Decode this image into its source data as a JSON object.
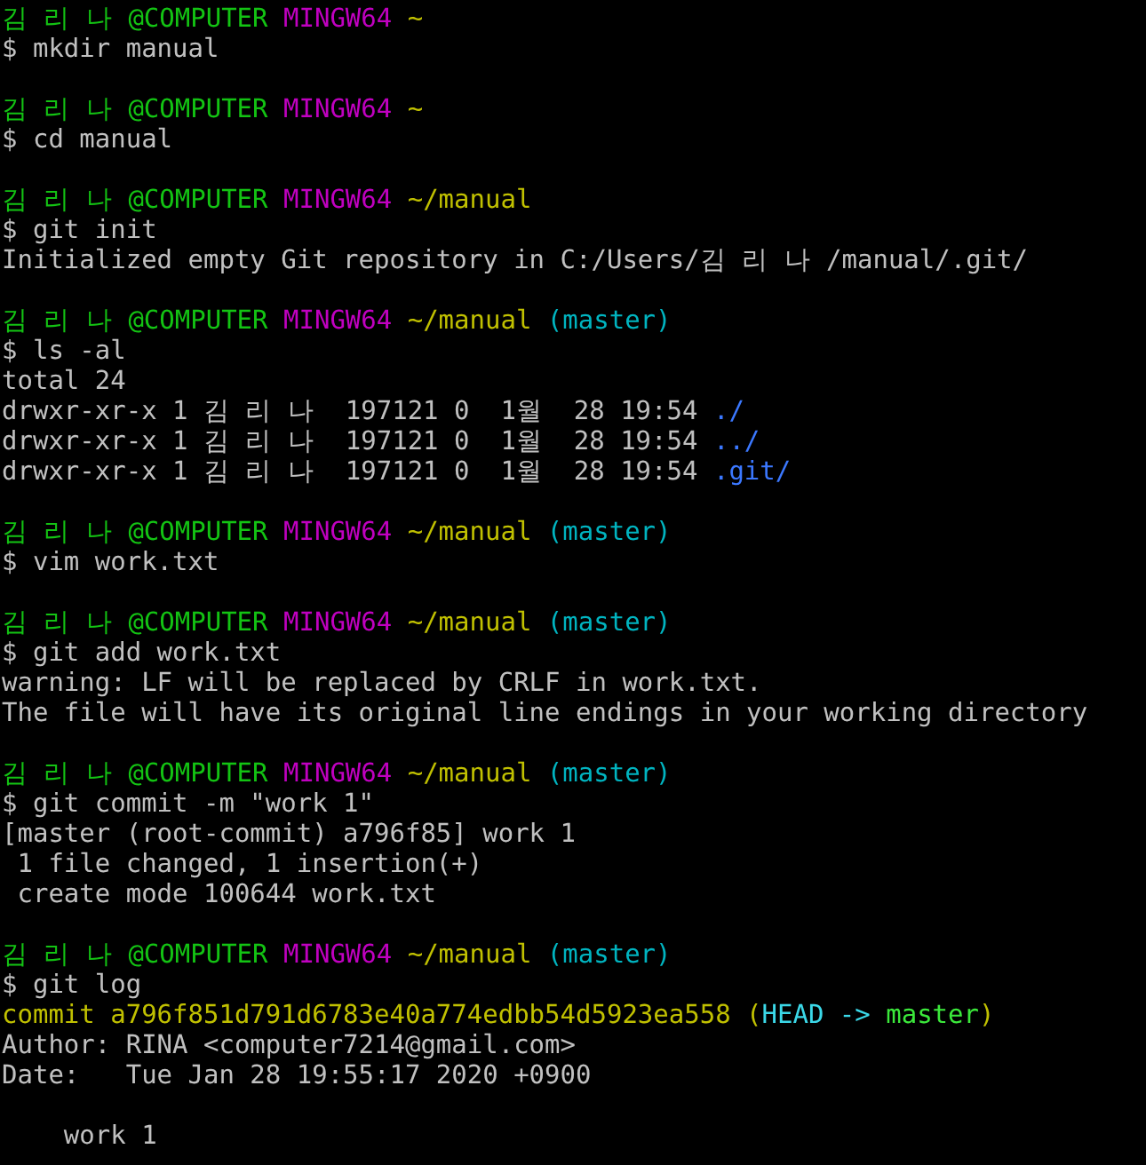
{
  "terminal": {
    "lines": [
      {
        "kind": "prompt",
        "segments": [
          {
            "text": "김 리 나 @COMPUTER ",
            "color": "#13c313"
          },
          {
            "text": "MINGW64 ",
            "color": "#c000c0"
          },
          {
            "text": "~",
            "color": "#c0c000"
          }
        ]
      },
      {
        "kind": "command",
        "segments": [
          {
            "text": "$ mkdir manual",
            "color": "#c0c0c0"
          }
        ]
      },
      {
        "kind": "blank"
      },
      {
        "kind": "prompt",
        "segments": [
          {
            "text": "김 리 나 @COMPUTER ",
            "color": "#13c313"
          },
          {
            "text": "MINGW64 ",
            "color": "#c000c0"
          },
          {
            "text": "~",
            "color": "#c0c000"
          }
        ]
      },
      {
        "kind": "command",
        "segments": [
          {
            "text": "$ cd manual",
            "color": "#c0c0c0"
          }
        ]
      },
      {
        "kind": "blank"
      },
      {
        "kind": "prompt",
        "segments": [
          {
            "text": "김 리 나 @COMPUTER ",
            "color": "#13c313"
          },
          {
            "text": "MINGW64 ",
            "color": "#c000c0"
          },
          {
            "text": "~/manual",
            "color": "#c0c000"
          }
        ]
      },
      {
        "kind": "command",
        "segments": [
          {
            "text": "$ git init",
            "color": "#c0c0c0"
          }
        ]
      },
      {
        "kind": "output",
        "segments": [
          {
            "text": "Initialized empty Git repository in C:/Users/김 리 나 /manual/.git/",
            "color": "#c0c0c0"
          }
        ]
      },
      {
        "kind": "blank"
      },
      {
        "kind": "prompt",
        "segments": [
          {
            "text": "김 리 나 @COMPUTER ",
            "color": "#13c313"
          },
          {
            "text": "MINGW64 ",
            "color": "#c000c0"
          },
          {
            "text": "~/manual ",
            "color": "#c0c000"
          },
          {
            "text": "(master)",
            "color": "#00b4c0"
          }
        ]
      },
      {
        "kind": "command",
        "segments": [
          {
            "text": "$ ls -al",
            "color": "#c0c0c0"
          }
        ]
      },
      {
        "kind": "output",
        "segments": [
          {
            "text": "total 24",
            "color": "#c0c0c0"
          }
        ]
      },
      {
        "kind": "output",
        "segments": [
          {
            "text": "drwxr-xr-x 1 김 리 나  197121 0  1월  28 19:54 ",
            "color": "#c0c0c0"
          },
          {
            "text": "./",
            "color": "#3b78ff"
          }
        ]
      },
      {
        "kind": "output",
        "segments": [
          {
            "text": "drwxr-xr-x 1 김 리 나  197121 0  1월  28 19:54 ",
            "color": "#c0c0c0"
          },
          {
            "text": "../",
            "color": "#3b78ff"
          }
        ]
      },
      {
        "kind": "output",
        "segments": [
          {
            "text": "drwxr-xr-x 1 김 리 나  197121 0  1월  28 19:54 ",
            "color": "#c0c0c0"
          },
          {
            "text": ".git/",
            "color": "#3b78ff"
          }
        ]
      },
      {
        "kind": "blank"
      },
      {
        "kind": "prompt",
        "segments": [
          {
            "text": "김 리 나 @COMPUTER ",
            "color": "#13c313"
          },
          {
            "text": "MINGW64 ",
            "color": "#c000c0"
          },
          {
            "text": "~/manual ",
            "color": "#c0c000"
          },
          {
            "text": "(master)",
            "color": "#00b4c0"
          }
        ]
      },
      {
        "kind": "command",
        "segments": [
          {
            "text": "$ vim work.txt",
            "color": "#c0c0c0"
          }
        ]
      },
      {
        "kind": "blank"
      },
      {
        "kind": "prompt",
        "segments": [
          {
            "text": "김 리 나 @COMPUTER ",
            "color": "#13c313"
          },
          {
            "text": "MINGW64 ",
            "color": "#c000c0"
          },
          {
            "text": "~/manual ",
            "color": "#c0c000"
          },
          {
            "text": "(master)",
            "color": "#00b4c0"
          }
        ]
      },
      {
        "kind": "command",
        "segments": [
          {
            "text": "$ git add work.txt",
            "color": "#c0c0c0"
          }
        ]
      },
      {
        "kind": "output",
        "segments": [
          {
            "text": "warning: LF will be replaced by CRLF in work.txt.",
            "color": "#c0c0c0"
          }
        ]
      },
      {
        "kind": "output",
        "segments": [
          {
            "text": "The file will have its original line endings in your working directory",
            "color": "#c0c0c0"
          }
        ]
      },
      {
        "kind": "blank"
      },
      {
        "kind": "prompt",
        "segments": [
          {
            "text": "김 리 나 @COMPUTER ",
            "color": "#13c313"
          },
          {
            "text": "MINGW64 ",
            "color": "#c000c0"
          },
          {
            "text": "~/manual ",
            "color": "#c0c000"
          },
          {
            "text": "(master)",
            "color": "#00b4c0"
          }
        ]
      },
      {
        "kind": "command",
        "segments": [
          {
            "text": "$ git commit -m \"work 1\"",
            "color": "#c0c0c0"
          }
        ]
      },
      {
        "kind": "output",
        "segments": [
          {
            "text": "[master (root-commit) a796f85] work 1",
            "color": "#c0c0c0"
          }
        ]
      },
      {
        "kind": "output",
        "segments": [
          {
            "text": " 1 file changed, 1 insertion(+)",
            "color": "#c0c0c0"
          }
        ]
      },
      {
        "kind": "output",
        "segments": [
          {
            "text": " create mode 100644 work.txt",
            "color": "#c0c0c0"
          }
        ]
      },
      {
        "kind": "blank"
      },
      {
        "kind": "prompt",
        "segments": [
          {
            "text": "김 리 나 @COMPUTER ",
            "color": "#13c313"
          },
          {
            "text": "MINGW64 ",
            "color": "#c000c0"
          },
          {
            "text": "~/manual ",
            "color": "#c0c000"
          },
          {
            "text": "(master)",
            "color": "#00b4c0"
          }
        ]
      },
      {
        "kind": "command",
        "segments": [
          {
            "text": "$ git log",
            "color": "#c0c0c0"
          }
        ]
      },
      {
        "kind": "output",
        "segments": [
          {
            "text": "commit a796f851d791d6783e40a774edbb54d5923ea558 (",
            "color": "#c0c000"
          },
          {
            "text": "HEAD -> ",
            "color": "#3bd8e8"
          },
          {
            "text": "master",
            "color": "#3be83b"
          },
          {
            "text": ")",
            "color": "#c0c000"
          }
        ]
      },
      {
        "kind": "output",
        "segments": [
          {
            "text": "Author: RINA <computer7214@gmail.com>",
            "color": "#c0c0c0"
          }
        ]
      },
      {
        "kind": "output",
        "segments": [
          {
            "text": "Date:   Tue Jan 28 19:55:17 2020 +0900",
            "color": "#c0c0c0"
          }
        ]
      },
      {
        "kind": "blank"
      },
      {
        "kind": "output",
        "segments": [
          {
            "text": "    work 1",
            "color": "#c0c0c0"
          }
        ]
      }
    ]
  }
}
